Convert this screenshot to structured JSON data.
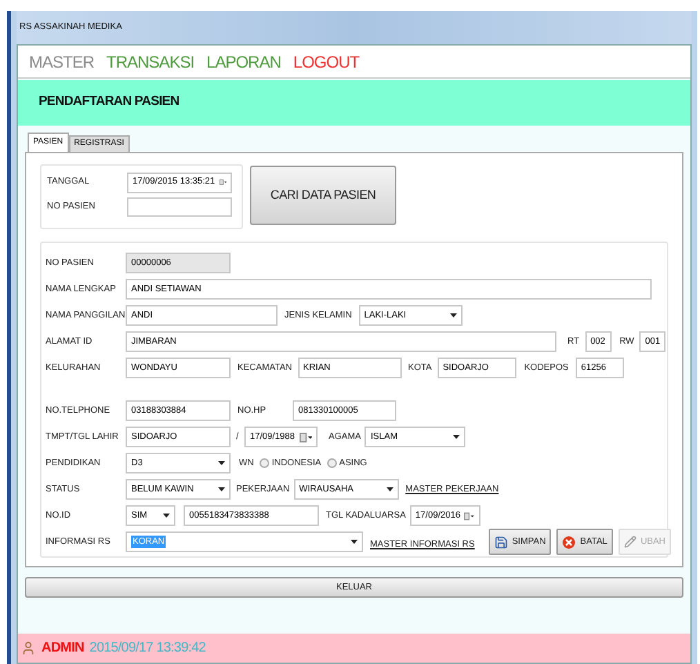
{
  "window": {
    "title": "RS ASSAKINAH MEDIKA"
  },
  "menu": [
    {
      "label": "MASTER",
      "color": "#8a8a8a"
    },
    {
      "label": "TRANSAKSI",
      "color": "#4f9a3f"
    },
    {
      "label": "LAPORAN",
      "color": "#4f9a3f"
    },
    {
      "label": "LOGOUT",
      "color": "#ee3030"
    }
  ],
  "header": {
    "title": "PENDAFTARAN PASIEN"
  },
  "tabs": [
    {
      "label": "PASIEN",
      "selected": true
    },
    {
      "label": "REGISTRASI",
      "selected": false
    }
  ],
  "search": {
    "tanggal": {
      "label": "TANGGAL",
      "value": "17/09/2015 13:35:21"
    },
    "no_pasien": {
      "label": "NO PASIEN"
    },
    "button": "CARI DATA PASIEN"
  },
  "form": {
    "no_pasien": {
      "label": "NO PASIEN",
      "value": "00000006"
    },
    "nama_lengkap": {
      "label": "NAMA LENGKAP",
      "value": "ANDI SETIAWAN"
    },
    "nama_panggilan": {
      "label": "NAMA PANGGILAN",
      "value": "ANDI"
    },
    "jenis_kelamin": {
      "label": "JENIS KELAMIN",
      "value": "LAKI-LAKI"
    },
    "alamat": {
      "label": "ALAMAT ID",
      "value": "JIMBARAN"
    },
    "rt": {
      "label": "RT",
      "value": "002"
    },
    "rw": {
      "label": "RW",
      "value": "001"
    },
    "kelurahan": {
      "label": "KELURAHAN",
      "value": "WONDAYU"
    },
    "kecamatan": {
      "label": "KECAMATAN",
      "value": "KRIAN"
    },
    "kota": {
      "label": "KOTA",
      "value": "SIDOARJO"
    },
    "kodepos": {
      "label": "KODEPOS",
      "value": "61256"
    },
    "telphone": {
      "label": "NO.TELPHONE",
      "value": "03188303884"
    },
    "hp": {
      "label": "NO.HP",
      "value": "081330100005"
    },
    "tempat_lahir": {
      "label": "TMPT/TGL LAHIR",
      "value": "SIDOARJO"
    },
    "separator": "/",
    "tgl_lahir": {
      "value": "17/09/1988"
    },
    "agama": {
      "label": "AGAMA",
      "value": "ISLAM"
    },
    "pendidikan": {
      "label": "PENDIDIKAN",
      "value": "D3"
    },
    "wn": {
      "label": "WN",
      "options": [
        {
          "label": "INDONESIA",
          "selected": false
        },
        {
          "label": "ASING",
          "selected": false
        }
      ]
    },
    "status": {
      "label": "STATUS",
      "value": "BELUM KAWIN"
    },
    "pekerjaan": {
      "label": "PEKERJAAN",
      "value": "WIRAUSAHA"
    },
    "master_pekerjaan": "MASTER PEKERJAAN",
    "no_id": {
      "label": "NO.ID",
      "type": "SIM",
      "value": "0055183473833388"
    },
    "tgl_kadaluarsa": {
      "label": "TGL KADALUARSA",
      "value": "17/09/2016"
    },
    "informasi_rs": {
      "label": "INFORMASI RS",
      "value": "KORAN",
      "highlighted": true
    },
    "master_informasi": "MASTER INFORMASI RS"
  },
  "actions": [
    {
      "kind": "save",
      "label": "SIMPAN",
      "disabled": false
    },
    {
      "kind": "cancel",
      "label": "BATAL",
      "disabled": false
    },
    {
      "kind": "edit",
      "label": "UBAH",
      "disabled": true
    }
  ],
  "exit_button": "KELUAR",
  "status_bar": {
    "user": "ADMIN",
    "datetime": "2015/09/17 13:39:42"
  }
}
